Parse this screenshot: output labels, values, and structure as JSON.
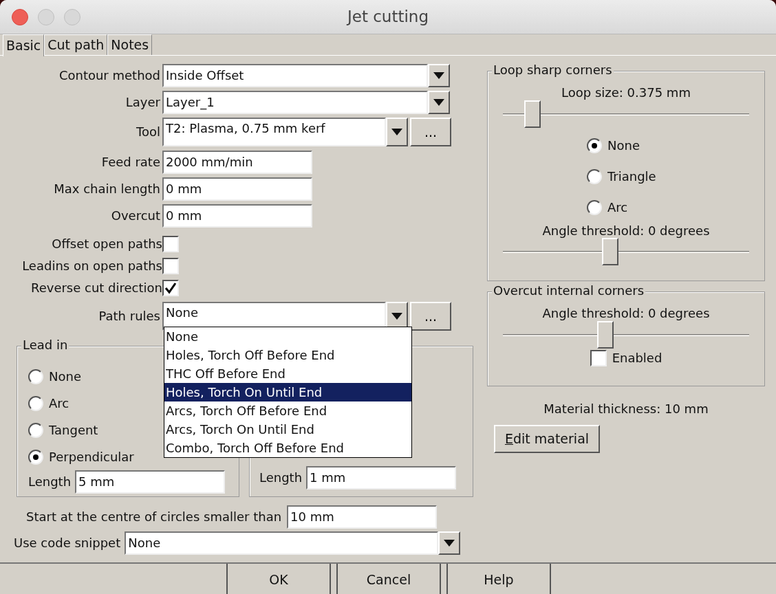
{
  "window": {
    "title": "Jet cutting"
  },
  "tabs": [
    {
      "label": "Basic",
      "selected": true
    },
    {
      "label": "Cut path",
      "selected": false
    },
    {
      "label": "Notes",
      "selected": false
    }
  ],
  "form": {
    "rows": [
      {
        "kind": "combo",
        "label": "Contour method",
        "value": "Inside Offset"
      },
      {
        "kind": "combo",
        "label": "Layer",
        "value": "Layer_1"
      },
      {
        "kind": "combo",
        "label": "Tool",
        "value": "T2: Plasma, 0.75 mm kerf",
        "button": "..."
      },
      {
        "kind": "text",
        "label": "Feed rate",
        "value": "2000 mm/min"
      },
      {
        "kind": "text",
        "label": "Max chain length",
        "value": "0 mm"
      },
      {
        "kind": "text",
        "label": "Overcut",
        "value": "0 mm"
      },
      {
        "kind": "checkbox",
        "label": "Offset open paths",
        "checked": false
      },
      {
        "kind": "checkbox",
        "label": "Leadins on open paths",
        "checked": false
      },
      {
        "kind": "checkbox",
        "label": "Reverse cut direction",
        "checked": true
      },
      {
        "kind": "combo",
        "label": "Path rules",
        "value": "None",
        "button": "...",
        "popup": [
          {
            "label": "None",
            "highlighted": false
          },
          {
            "label": "Holes, Torch Off Before End",
            "highlighted": false
          },
          {
            "label": "THC Off Before End",
            "highlighted": false
          },
          {
            "label": "Holes, Torch On Until End",
            "highlighted": true
          },
          {
            "label": "Arcs, Torch Off Before End",
            "highlighted": false
          },
          {
            "label": "Arcs, Torch On Until End",
            "highlighted": false
          },
          {
            "label": "Combo, Torch Off Before End",
            "highlighted": false
          }
        ]
      }
    ]
  },
  "lead_in": {
    "title": "Lead in",
    "options": [
      {
        "label": "None",
        "selected": false
      },
      {
        "label": "Arc",
        "selected": false
      },
      {
        "label": "Tangent",
        "selected": false
      },
      {
        "label": "Perpendicular",
        "selected": true
      }
    ],
    "length_label": "Length",
    "length_value": "5 mm"
  },
  "lead_out": {
    "length_label": "Length",
    "length_value": "1 mm"
  },
  "start_centre": {
    "label": "Start at the centre of circles smaller than",
    "value": "10 mm"
  },
  "code_snippet": {
    "label": "Use code snippet",
    "value": "None"
  },
  "loop_sharp_corners": {
    "title": "Loop sharp corners",
    "size_label": "Loop size: 0.375 mm",
    "size_slider": {
      "level": 0.12
    },
    "options": [
      {
        "label": "None",
        "selected": true
      },
      {
        "label": "Triangle",
        "selected": false
      },
      {
        "label": "Arc",
        "selected": false
      }
    ],
    "angle_label": "Angle threshold: 0 degrees",
    "angle_slider": {
      "level": 0.435
    }
  },
  "overcut_internal_corners": {
    "title": "Overcut internal corners",
    "angle_label": "Angle threshold: 0 degrees",
    "angle_slider": {
      "level": 0.415
    },
    "enabled": {
      "label": "Enabled",
      "checked": false
    }
  },
  "material": {
    "thickness_label": "Material thickness: 10 mm",
    "edit_button": "Edit material"
  },
  "buttons": [
    "OK",
    "Cancel",
    "Help"
  ]
}
